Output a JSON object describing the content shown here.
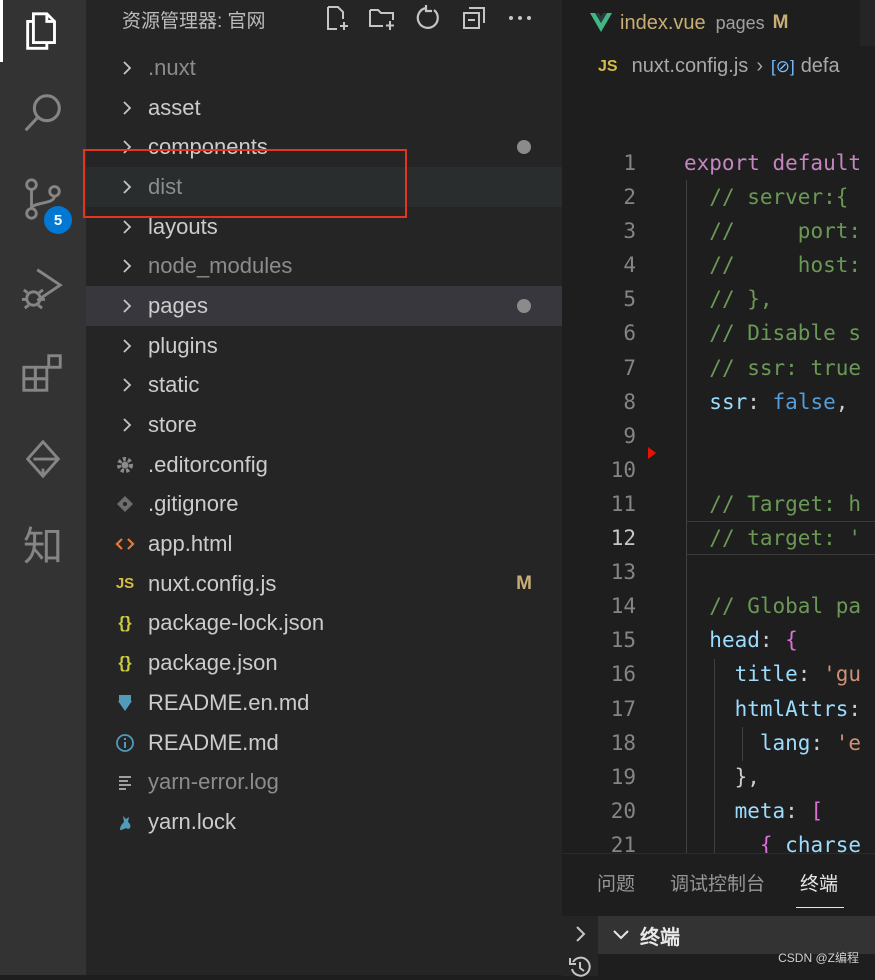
{
  "explorer": {
    "title": "资源管理器: 官网",
    "items": [
      {
        "label": ".nuxt",
        "type": "folder",
        "dim": true
      },
      {
        "label": "asset",
        "type": "folder"
      },
      {
        "label": "components",
        "type": "folder",
        "dot": true
      },
      {
        "label": "dist",
        "type": "folder",
        "dim": true
      },
      {
        "label": "layouts",
        "type": "folder"
      },
      {
        "label": "node_modules",
        "type": "folder",
        "dim": true
      },
      {
        "label": "pages",
        "type": "folder",
        "dot": true
      },
      {
        "label": "plugins",
        "type": "folder"
      },
      {
        "label": "static",
        "type": "folder"
      },
      {
        "label": "store",
        "type": "folder"
      },
      {
        "label": ".editorconfig",
        "icon": "gear-icon"
      },
      {
        "label": ".gitignore",
        "icon": "git-icon"
      },
      {
        "label": "app.html",
        "icon": "html-icon"
      },
      {
        "label": "nuxt.config.js",
        "icon": "js-icon",
        "status": "M"
      },
      {
        "label": "package-lock.json",
        "icon": "json-icon"
      },
      {
        "label": "package.json",
        "icon": "json-icon"
      },
      {
        "label": "README.en.md",
        "icon": "download-icon"
      },
      {
        "label": "README.md",
        "icon": "info-icon"
      },
      {
        "label": "yarn-error.log",
        "icon": "log-icon",
        "dim": true
      },
      {
        "label": "yarn.lock",
        "icon": "yarn-icon"
      }
    ]
  },
  "activity": {
    "scm_badge": "5",
    "zhi_label": "知"
  },
  "editor": {
    "tab": {
      "name": "index.vue",
      "desc": "pages",
      "status": "M"
    },
    "breadcrumb": {
      "file_badge": "JS",
      "file": "nuxt.config.js",
      "symbol": "defa"
    },
    "current_line": 12,
    "lines": [
      {
        "n": "1",
        "t": "export default"
      },
      {
        "n": "2",
        "t": "  // server:{"
      },
      {
        "n": "3",
        "t": "  //     port:"
      },
      {
        "n": "4",
        "t": "  //     host:"
      },
      {
        "n": "5",
        "t": "  // },"
      },
      {
        "n": "6",
        "t": "  // Disable s"
      },
      {
        "n": "7",
        "t": "  // ssr: true"
      },
      {
        "n": "8",
        "t": "  ssr: false,"
      },
      {
        "n": "9",
        "t": ""
      },
      {
        "n": "10",
        "t": ""
      },
      {
        "n": "11",
        "t": "  // Target: h"
      },
      {
        "n": "12",
        "t": "  // target: '"
      },
      {
        "n": "13",
        "t": ""
      },
      {
        "n": "14",
        "t": "  // Global pa"
      },
      {
        "n": "15",
        "t": "  head: {"
      },
      {
        "n": "16",
        "t": "    title: 'gu"
      },
      {
        "n": "17",
        "t": "    htmlAttrs:"
      },
      {
        "n": "18",
        "t": "      lang: 'e"
      },
      {
        "n": "19",
        "t": "    },"
      },
      {
        "n": "20",
        "t": "    meta: ["
      },
      {
        "n": "21",
        "t": "      { charse"
      }
    ]
  },
  "panel": {
    "tabs": [
      "问题",
      "调试控制台",
      "终端"
    ],
    "active_tab": "终端",
    "terminal_title": "终端"
  },
  "watermark": "CSDN @Z编程",
  "colors": {
    "highlight_box": "#e5331e",
    "badge": "#0078d4",
    "modified": "#c8ae74"
  }
}
